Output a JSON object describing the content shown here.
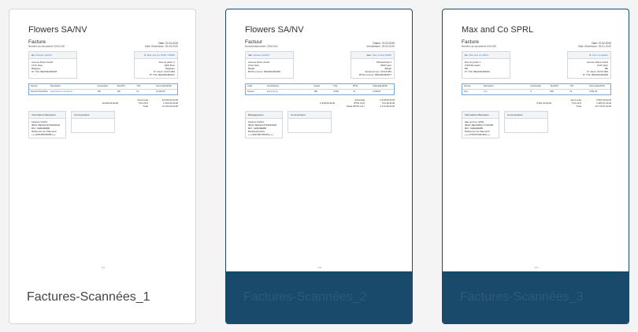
{
  "cards": [
    {
      "caption": "Factures-Scannées_1",
      "selected": false,
      "doc": {
        "company": "Flowers SA/NV",
        "title": "Facture",
        "date": "Date: 07-03-2019",
        "doc_number": "Numéro du document: 2019-016",
        "due": "Date d'échéance: 09-05-2019",
        "from_label": "De:",
        "from_name": "Flowers SA/NV",
        "to_label": "À:",
        "to_name": "Max and Co SPRL / BVBA",
        "from_addr": [
          "Avenue Reine Astrid",
          "1310 Jette",
          "Belgique",
          "N° TVA: BE0630484928"
        ],
        "to_addr": [
          "Rue du jardin 1",
          "1000 Brux",
          "Belgique",
          "N° client: CUST-083",
          "N° TVA: BE0630484931"
        ],
        "line_headers": [
          "Service",
          "Description",
          "Heures/Qté",
          "Taux/Prix",
          "TVA",
          "Sous-total (EUR)"
        ],
        "line_row": [
          "Service Photo/Test",
          "Description du produit ici",
          "100",
          "100",
          "21",
          "10.000,00"
        ],
        "totals_labels": [
          "Sous-total",
          "TVA 21%",
          "Total"
        ],
        "totals_left": [
          "",
          "10.000,00 EUR",
          ""
        ],
        "totals_values": [
          "10.000,00 EUR",
          "2.100,00 EUR",
          "12.100,00 EUR"
        ],
        "bank_header": "Informations Bancaires",
        "bank_lines": [
          "Flowers SA/NV",
          "IBAN: BE10103735025629",
          "BIC: GEBABEBB",
          "Référence de Paiement: +++25/0383/65685+++"
        ],
        "comment_header": "Commentaires",
        "page": "1/1"
      }
    },
    {
      "caption": "Factures-Scannées_2",
      "selected": true,
      "doc": {
        "company": "Flowers SA/NV",
        "title": "Factuur",
        "date": "Datum: 07-03-2019",
        "doc_number": "Documentnummer: 2019-016",
        "due": "Vervaldatum: 09-05-2019",
        "from_label": "Van:",
        "from_name": "Flowers SA/NV",
        "to_label": "Aan:",
        "to_name": "John & Doe BVBA",
        "from_addr": [
          "Avenue Reine Astrid",
          "1310 Jette",
          "België",
          "BTW-nummer: BE0630484928"
        ],
        "to_addr": [
          "Winkelstraat 4",
          "3000 Gent",
          "België",
          "Klantnummer: CUST-083",
          "BTW-nummer: BE0630484877"
        ],
        "line_headers": [
          "Code",
          "Omschrijving",
          "Aantal",
          "Prijs",
          "BTW",
          "Subtotaal (EUR)"
        ],
        "line_row": [
          "Service",
          "Beschrijving",
          "180",
          "20,00",
          "21",
          "3.448,50"
        ],
        "totals_labels": [
          "Subtotaal",
          "BTW 21%",
          "Totaal (BTW incl.)"
        ],
        "totals_left": [
          "",
          "3.448,50 EUR",
          ""
        ],
        "totals_values": [
          "3.448,50 EUR",
          "724,18 EUR",
          "4.172,68 EUR"
        ],
        "bank_header": "Bankgegevens",
        "bank_lines": [
          "Flowers SA/NV",
          "IBAN: BE10103735025629",
          "BIC: GEBABEBB",
          "Betalingsreferte: +++362/4067/80321+++"
        ],
        "comment_header": "Commentaren",
        "page": "1/1"
      }
    },
    {
      "caption": "Factures-Scannées_3",
      "selected": true,
      "doc": {
        "company": "Max and Co SPRL",
        "title": "Facture",
        "date": "Date: 27-02-2019",
        "doc_number": "Numéro du document: INV-009",
        "due": "Date d'échéance: 09-01-2019",
        "from_label": "De:",
        "from_name": "Max and Co SPRL",
        "to_label": "À:",
        "to_name": "Test comptable",
        "from_addr": [
          "Rue du jardin 1",
          "1000 Bruxelles",
          "BE",
          "N° TVA: BE0630484931"
        ],
        "to_addr": [
          "Avenue Reine Astrid",
          "1310 Jette",
          "BE",
          "N° client: CUST-083",
          "N° TVA: BE0630484928"
        ],
        "line_headers": [
          "Service",
          "Description",
          "Heures/Qté",
          "Taux/Prix",
          "TVA",
          "Sous-total (EUR)"
        ],
        "line_row": [
          "Test",
          "Test",
          "5",
          "800",
          "21",
          "3.601,00"
        ],
        "totals_labels": [
          "Sous-total",
          "TVA 21%",
          "Total"
        ],
        "totals_left": [
          "",
          "6.601,00 EUR",
          ""
        ],
        "totals_values": [
          "6.601,00 EUR",
          "1.385,21 EUR",
          "16.778,21 EUR"
        ],
        "bank_header": "Informations Bancaires",
        "bank_lines": [
          "Max and Co SPRL",
          "IBAN: BE02983171726558",
          "BIC: GEBABEBB",
          "Référence de Paiement: +++175/0073/92493+++"
        ],
        "comment_header": "Commentaires",
        "page": "1/1"
      }
    }
  ]
}
